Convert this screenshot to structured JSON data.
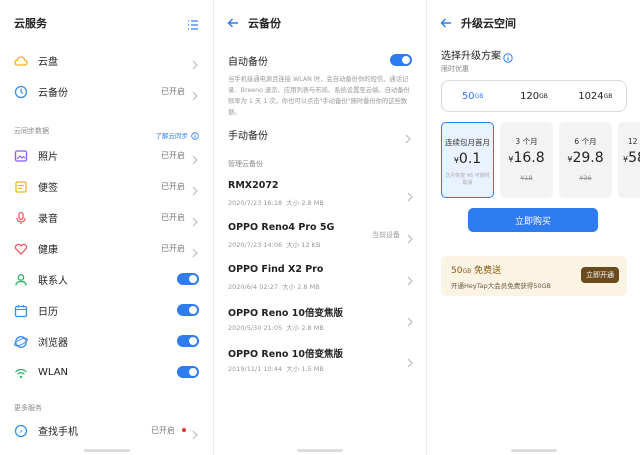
{
  "panel1": {
    "title": "云服务",
    "top_items": [
      {
        "label": "云盘",
        "status": "",
        "icon": "cloud-icon"
      },
      {
        "label": "云备份",
        "status": "已开启",
        "icon": "backup-icon"
      }
    ],
    "sync_section": {
      "heading": "云同步数据",
      "link": "了解云同步"
    },
    "sync_items": [
      {
        "label": "照片",
        "status": "已开启",
        "icon": "photo-icon"
      },
      {
        "label": "便签",
        "status": "已开启",
        "icon": "notes-icon"
      },
      {
        "label": "录音",
        "status": "已开启",
        "icon": "recorder-icon"
      },
      {
        "label": "健康",
        "status": "已开启",
        "icon": "health-icon"
      },
      {
        "label": "联系人",
        "icon": "contacts-icon",
        "enabled": true
      },
      {
        "label": "日历",
        "icon": "calendar-icon",
        "enabled": true
      },
      {
        "label": "浏览器",
        "icon": "browser-icon",
        "enabled": true
      },
      {
        "label": "WLAN",
        "icon": "wifi-icon",
        "enabled": true
      }
    ],
    "more_section": {
      "heading": "更多服务"
    },
    "more_items": [
      {
        "label": "查找手机",
        "status": "已开启",
        "icon": "find-phone-icon"
      }
    ]
  },
  "panel2": {
    "title": "云备份",
    "auto_backup": {
      "label": "自动备份",
      "enabled": true,
      "description": "当手机接通电源且连接 WLAN 时，会自动备份你的短信、通话记录、Breeno 速览、应用列表与布局、系统设置至云端。自动备份频率为 1 天 1 次。你也可以点击\"手动备份\"随时备份你的这些数据。"
    },
    "manual_backup": "手动备份",
    "manage_heading": "管理云备份",
    "devices": [
      {
        "name": "RMX2072",
        "time": "2020/7/23 16:18",
        "size": "大小 2.8 MB",
        "current": ""
      },
      {
        "name": "OPPO Reno4 Pro 5G",
        "time": "2020/7/23 14:06",
        "size": "大小 12 KB",
        "current": "当前设备"
      },
      {
        "name": "OPPO Find X2 Pro",
        "time": "2020/6/4 02:27",
        "size": "大小 2.8 MB",
        "current": ""
      },
      {
        "name": "OPPO Reno 10倍变焦版",
        "time": "2020/5/30 21:05",
        "size": "大小 2.8 MB",
        "current": ""
      },
      {
        "name": "OPPO Reno 10倍变焦版",
        "time": "2019/11/1 10:44",
        "size": "大小 1.5 MB",
        "current": ""
      }
    ]
  },
  "panel3": {
    "title": "升级云空间",
    "subtitle": "选择升级方案",
    "limited": "限时优惠",
    "capacities": [
      {
        "value": "50",
        "unit": "GB",
        "selected": true
      },
      {
        "value": "120",
        "unit": "GB",
        "selected": false
      },
      {
        "value": "1024",
        "unit": "GB",
        "selected": false
      }
    ],
    "plans": [
      {
        "name": "连续包月首月",
        "price": "0.1",
        "old": "",
        "note": "次月恢复 ¥6 可随时取消",
        "selected": true
      },
      {
        "name": "3 个月",
        "price": "16.8",
        "old": "¥18",
        "note": "",
        "selected": false
      },
      {
        "name": "6 个月",
        "price": "29.8",
        "old": "¥36",
        "note": "",
        "selected": false
      },
      {
        "name": "12 个",
        "price": "58",
        "old": "",
        "note": "",
        "selected": false
      }
    ],
    "currency": "¥",
    "buy_label": "立即购买",
    "promo": {
      "title_value": "50",
      "title_unit": "GB",
      "title_rest": " 免费送",
      "subtitle": "开通HeyTap大会员免费获得50GB",
      "button": "立即开通"
    }
  },
  "colors": {
    "accent": "#2f7bf0"
  }
}
